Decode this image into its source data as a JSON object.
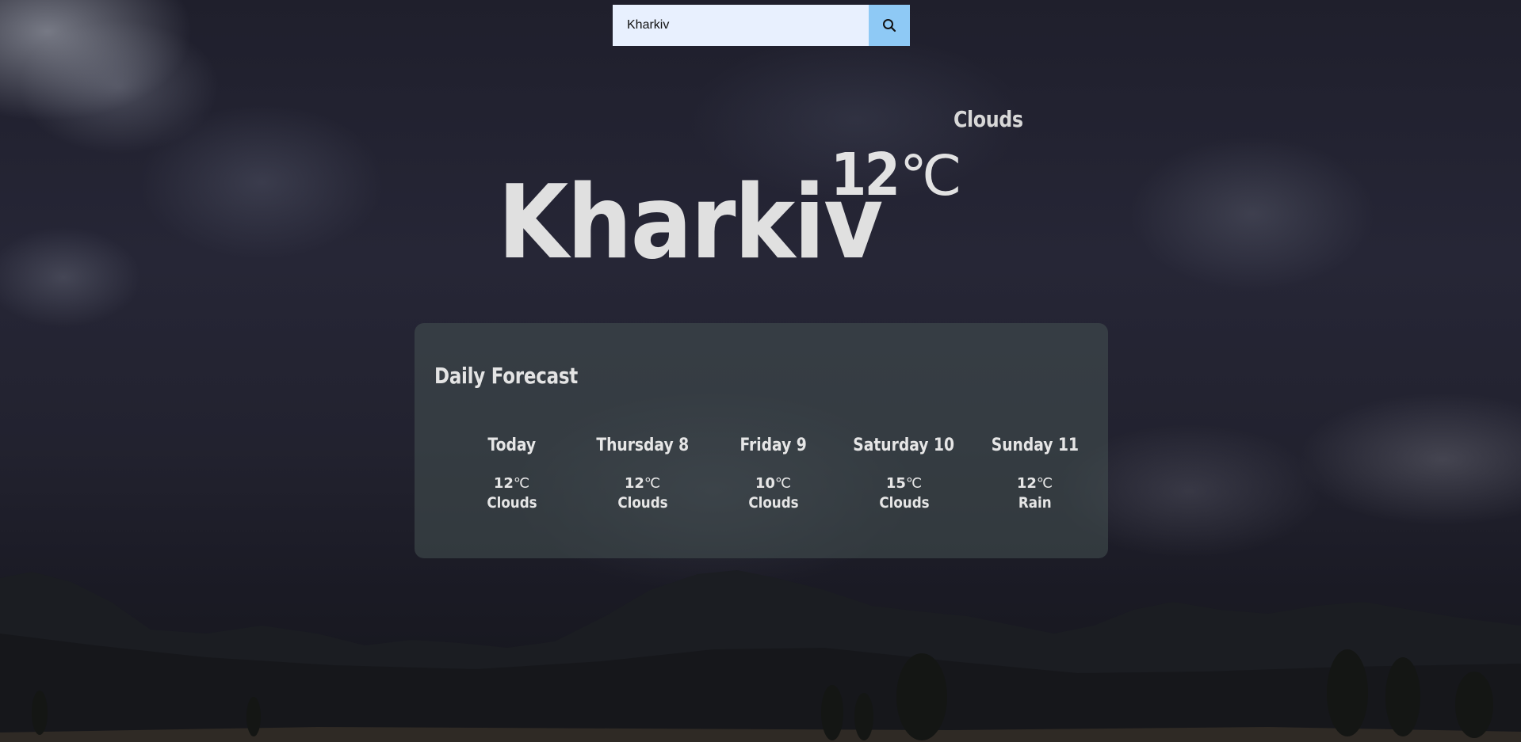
{
  "search": {
    "value": "Kharkiv",
    "icon": "search-icon"
  },
  "current": {
    "condition": "Clouds",
    "temperature": "12",
    "unit": "℃",
    "city": "Kharkiv"
  },
  "forecast": {
    "title": "Daily Forecast",
    "days": [
      {
        "name": "Today",
        "temp": "12",
        "unit": "℃",
        "condition": "Clouds"
      },
      {
        "name": "Thursday 8",
        "temp": "12",
        "unit": "℃",
        "condition": "Clouds"
      },
      {
        "name": "Friday 9",
        "temp": "10",
        "unit": "℃",
        "condition": "Clouds"
      },
      {
        "name": "Saturday 10",
        "temp": "15",
        "unit": "℃",
        "condition": "Clouds"
      },
      {
        "name": "Sunday 11",
        "temp": "12",
        "unit": "℃",
        "condition": "Rain"
      }
    ]
  },
  "colors": {
    "search_bg": "#e8f0fe",
    "search_button": "#8ec9f5",
    "text": "#e0e0e0"
  }
}
